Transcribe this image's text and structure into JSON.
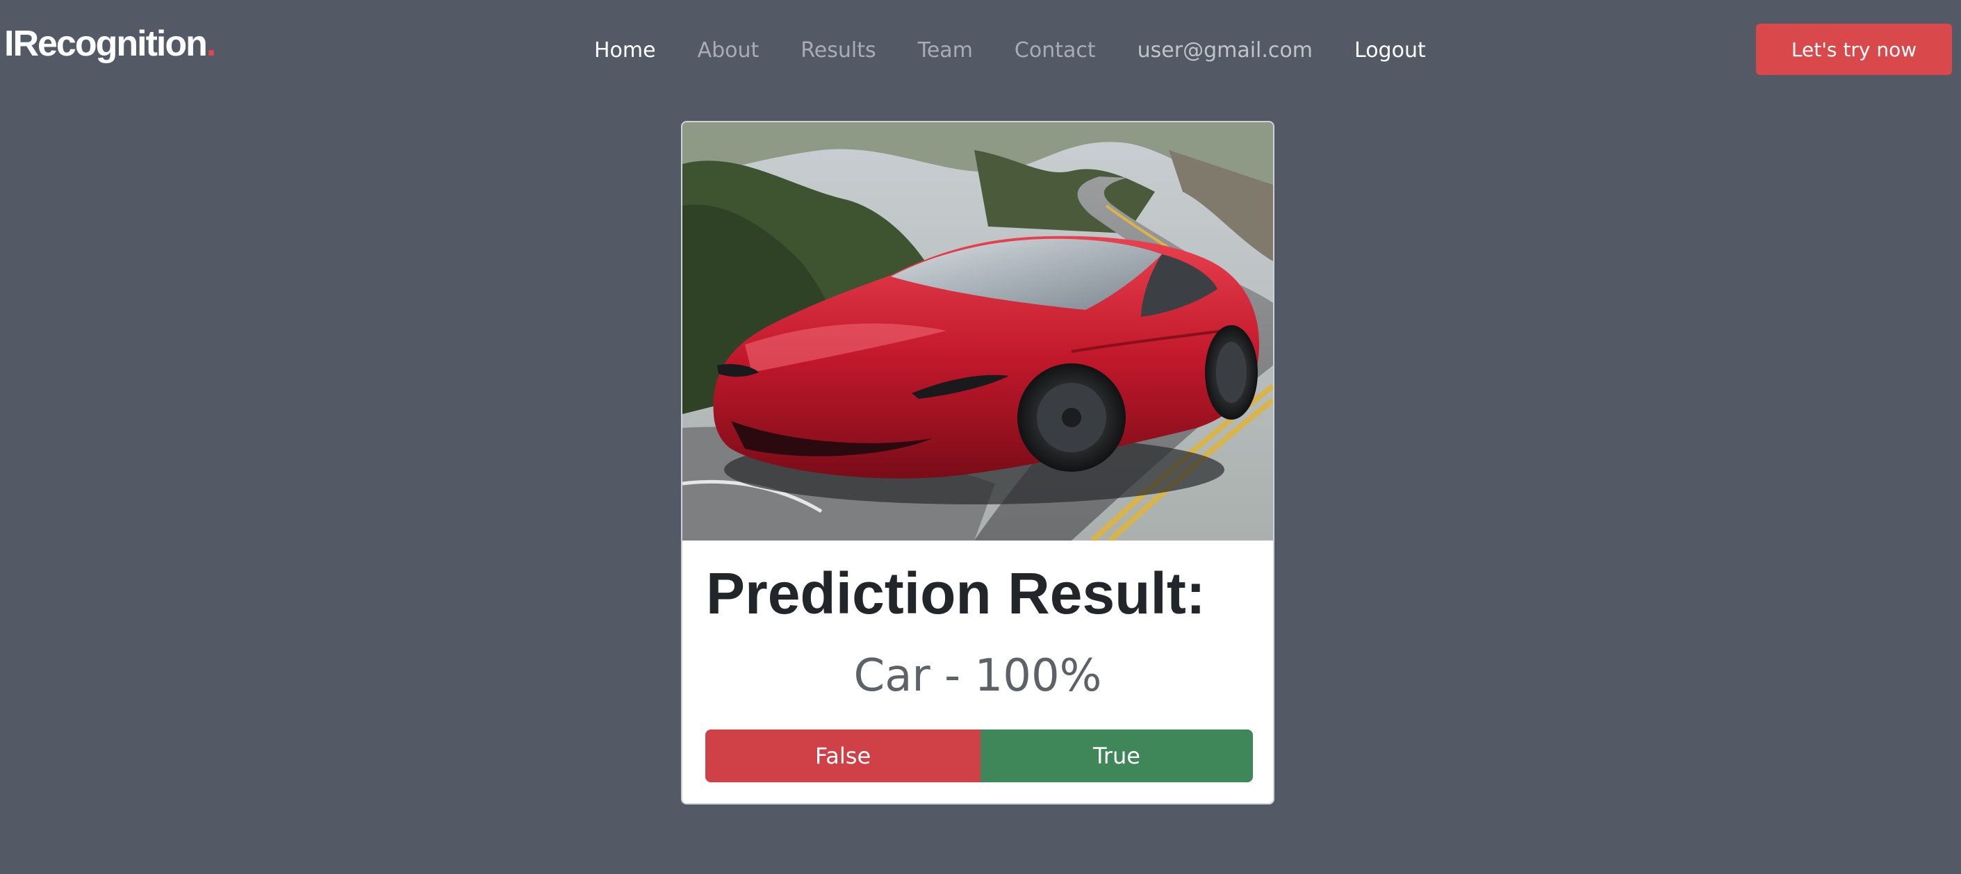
{
  "header": {
    "logo_text": "IRecognition",
    "logo_dot": ".",
    "nav": [
      {
        "label": "Home",
        "state": "active"
      },
      {
        "label": "About",
        "state": "inactive"
      },
      {
        "label": "Results",
        "state": "inactive"
      },
      {
        "label": "Team",
        "state": "inactive"
      },
      {
        "label": "Contact",
        "state": "inactive"
      },
      {
        "label": "user@gmail.com",
        "state": "user"
      },
      {
        "label": "Logout",
        "state": "active"
      }
    ],
    "cta_label": "Let's try now"
  },
  "card": {
    "image": "red sports car photo",
    "title": "Prediction Result:",
    "result": "Car - 100%",
    "false_label": "False",
    "true_label": "True"
  },
  "colors": {
    "background": "#535a66",
    "accent": "#d9484a",
    "false_button": "#cf4147",
    "true_button": "#3f8658"
  }
}
